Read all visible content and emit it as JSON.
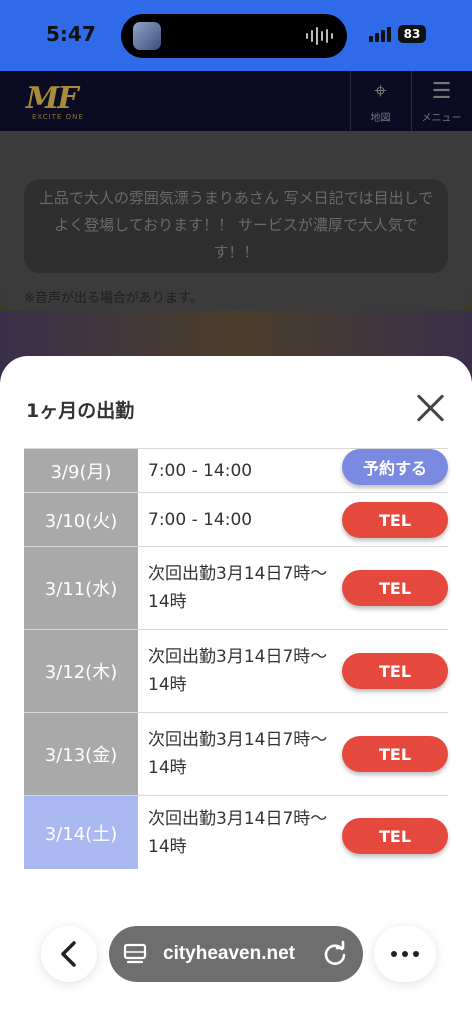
{
  "status_bar": {
    "time": "5:47",
    "battery": "83"
  },
  "site": {
    "logo": "MF",
    "logo_sub": "EXCITE ONE",
    "map_label": "地図",
    "menu_label": "メニュー",
    "intro_text": "上品で大人の雰囲気漂うまりあさん 写メ日記では目出しでよく登場しております！！ サービスが濃厚で大人気です！！",
    "note": "※音声が出る場合があります。"
  },
  "sheet": {
    "title": "1ヶ月の出勤",
    "rows": [
      {
        "date": "3/9(月)",
        "info": "7:00 - 14:00",
        "button": "予約する"
      },
      {
        "date": "3/10(火)",
        "info": "7:00 - 14:00",
        "button": "TEL"
      },
      {
        "date": "3/11(水)",
        "info": "次回出勤3月14日7時〜14時",
        "button": "TEL"
      },
      {
        "date": "3/12(木)",
        "info": "次回出勤3月14日7時〜14時",
        "button": "TEL"
      },
      {
        "date": "3/13(金)",
        "info": "次回出勤3月14日7時〜14時",
        "button": "TEL"
      },
      {
        "date": "3/14(土)",
        "info": "次回出勤3月14日7時〜14時",
        "button": "TEL"
      }
    ]
  },
  "browser": {
    "url": "cityheaven.net"
  },
  "colors": {
    "tel": "#e5483c",
    "reserve": "#7a8ae0",
    "today": "#a9b8f0",
    "date_bg": "#a9a9a9",
    "status_bar": "#2f6be8"
  }
}
